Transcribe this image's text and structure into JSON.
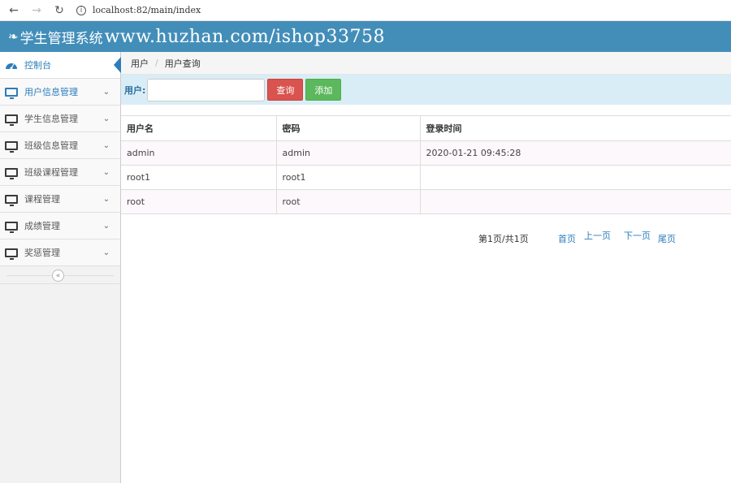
{
  "browser": {
    "url": "localhost:82/main/index"
  },
  "header": {
    "title": "学生管理系统",
    "watermark": "www.huzhan.com/ishop33758"
  },
  "sidebar": {
    "items": [
      {
        "label": "控制台",
        "icon": "dashboard-icon"
      },
      {
        "label": "用户信息管理",
        "icon": "monitor-icon"
      },
      {
        "label": "学生信息管理",
        "icon": "monitor-icon"
      },
      {
        "label": "班级信息管理",
        "icon": "monitor-icon"
      },
      {
        "label": "班级课程管理",
        "icon": "monitor-icon"
      },
      {
        "label": "课程管理",
        "icon": "monitor-icon"
      },
      {
        "label": "成绩管理",
        "icon": "monitor-icon"
      },
      {
        "label": "奖惩管理",
        "icon": "monitor-icon"
      }
    ],
    "collapse_label": "«"
  },
  "breadcrumb": {
    "items": [
      "用户",
      "用户查询"
    ]
  },
  "search": {
    "label": "用户:",
    "value": "",
    "query_button": "查询",
    "add_button": "添加"
  },
  "table": {
    "headers": [
      "用户名",
      "密码",
      "登录时间"
    ],
    "rows": [
      [
        "admin",
        "admin",
        "2020-01-21 09:45:28"
      ],
      [
        "root1",
        "root1",
        ""
      ],
      [
        "root",
        "root",
        ""
      ]
    ]
  },
  "pager": {
    "info": "第1页/共1页",
    "first": "首页",
    "prev": "上一页",
    "next": "下一页",
    "last": "尾页"
  },
  "colors": {
    "header_bg": "#438eb9",
    "accent": "#2b7dbc",
    "search_bg": "#d9edf7",
    "query_button": "#d9534f",
    "add_button": "#5cb85c"
  }
}
